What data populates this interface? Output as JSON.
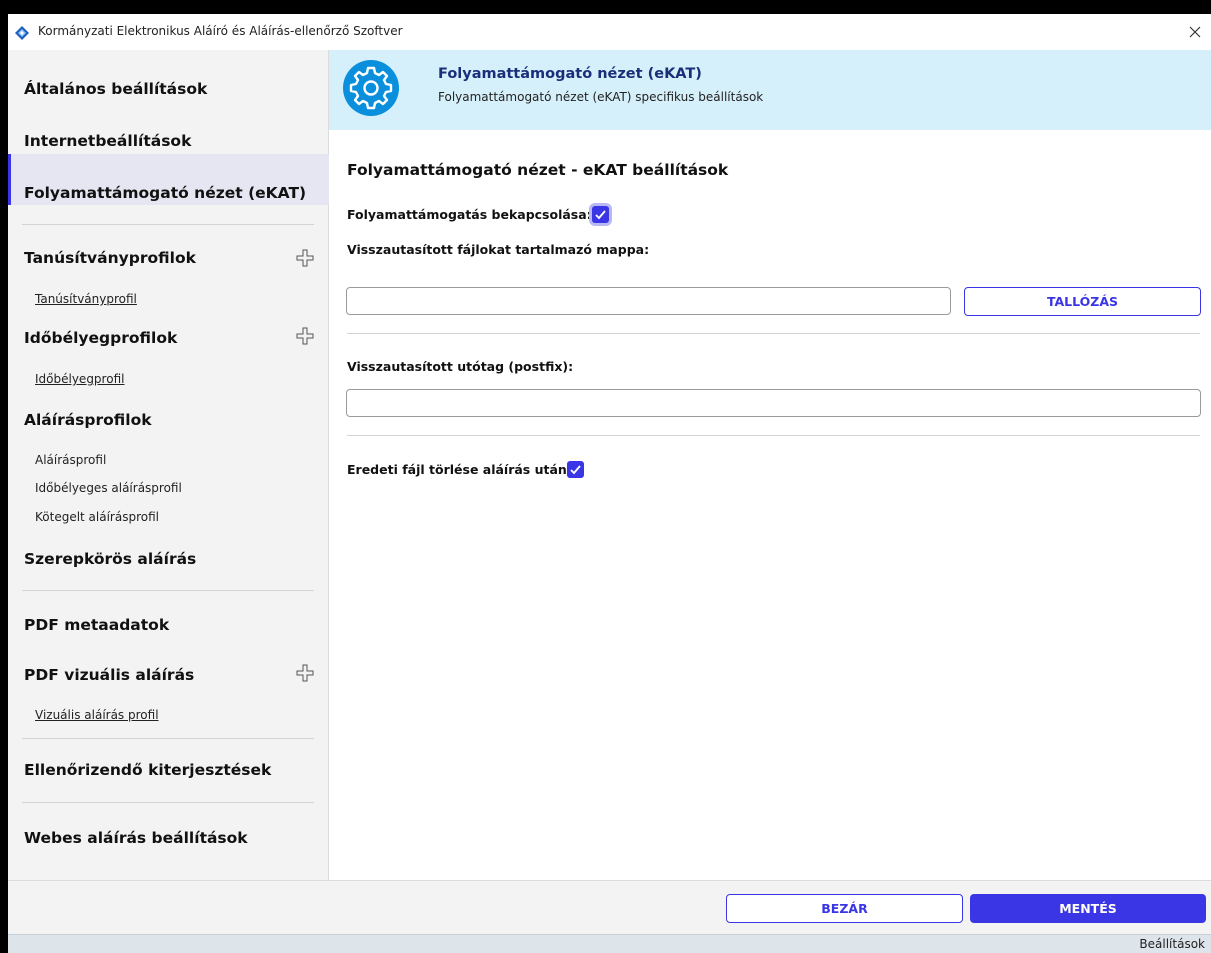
{
  "window": {
    "title": "Kormányzati Elektronikus Aláíró és Aláírás-ellenőrző Szoftver"
  },
  "sidebar": {
    "general": "Általános beállítások",
    "internet": "Internetbeállítások",
    "ekat": "Folyamattámogató nézet (eKAT)",
    "cert_profiles": "Tanúsítványprofilok",
    "cert_profile": "Tanúsítványprofil",
    "timestamp_profiles": "Időbélyegprofilok",
    "timestamp_profile": "Időbélyegprofil",
    "signature_profiles": "Aláírásprofilok",
    "signature_profile": "Aláírásprofil",
    "timestamped_signature_profile": "Időbélyeges aláírásprofil",
    "batch_signature_profile": "Kötegelt aláírásprofil",
    "role_signature": "Szerepkörös aláírás",
    "pdf_metadata": "PDF metaadatok",
    "pdf_visual_signature": "PDF vizuális aláírás",
    "visual_signature_profile": "Vizuális aláírás profil",
    "extensions": "Ellenőrizendő kiterjesztések",
    "web_signature": "Webes aláírás beállítások"
  },
  "header": {
    "title": "Folyamattámogató nézet (eKAT)",
    "subtitle": "Folyamattámogató nézet (eKAT) specifikus beállítások"
  },
  "main": {
    "section_title": "Folyamattámogató nézet - eKAT beállítások",
    "enable_label": "Folyamattámogatás bekapcsolása:",
    "enable_checked": true,
    "rejected_folder_label": "Visszautasított fájlokat tartalmazó mappa:",
    "rejected_folder_value": "",
    "browse_button": "TALLÓZÁS",
    "postfix_label": "Visszautasított utótag (postfix):",
    "postfix_value": "",
    "delete_original_label": "Eredeti fájl törlése aláírás után:",
    "delete_original_checked": true
  },
  "footer": {
    "close_button": "BEZÁR",
    "save_button": "MENTÉS"
  },
  "statusbar": {
    "text": "Beállítások"
  },
  "colors": {
    "accent": "#3a36e6",
    "header_bg": "#d6f0fb",
    "header_title": "#1a2f7a",
    "badge": "#0a8fdc"
  }
}
